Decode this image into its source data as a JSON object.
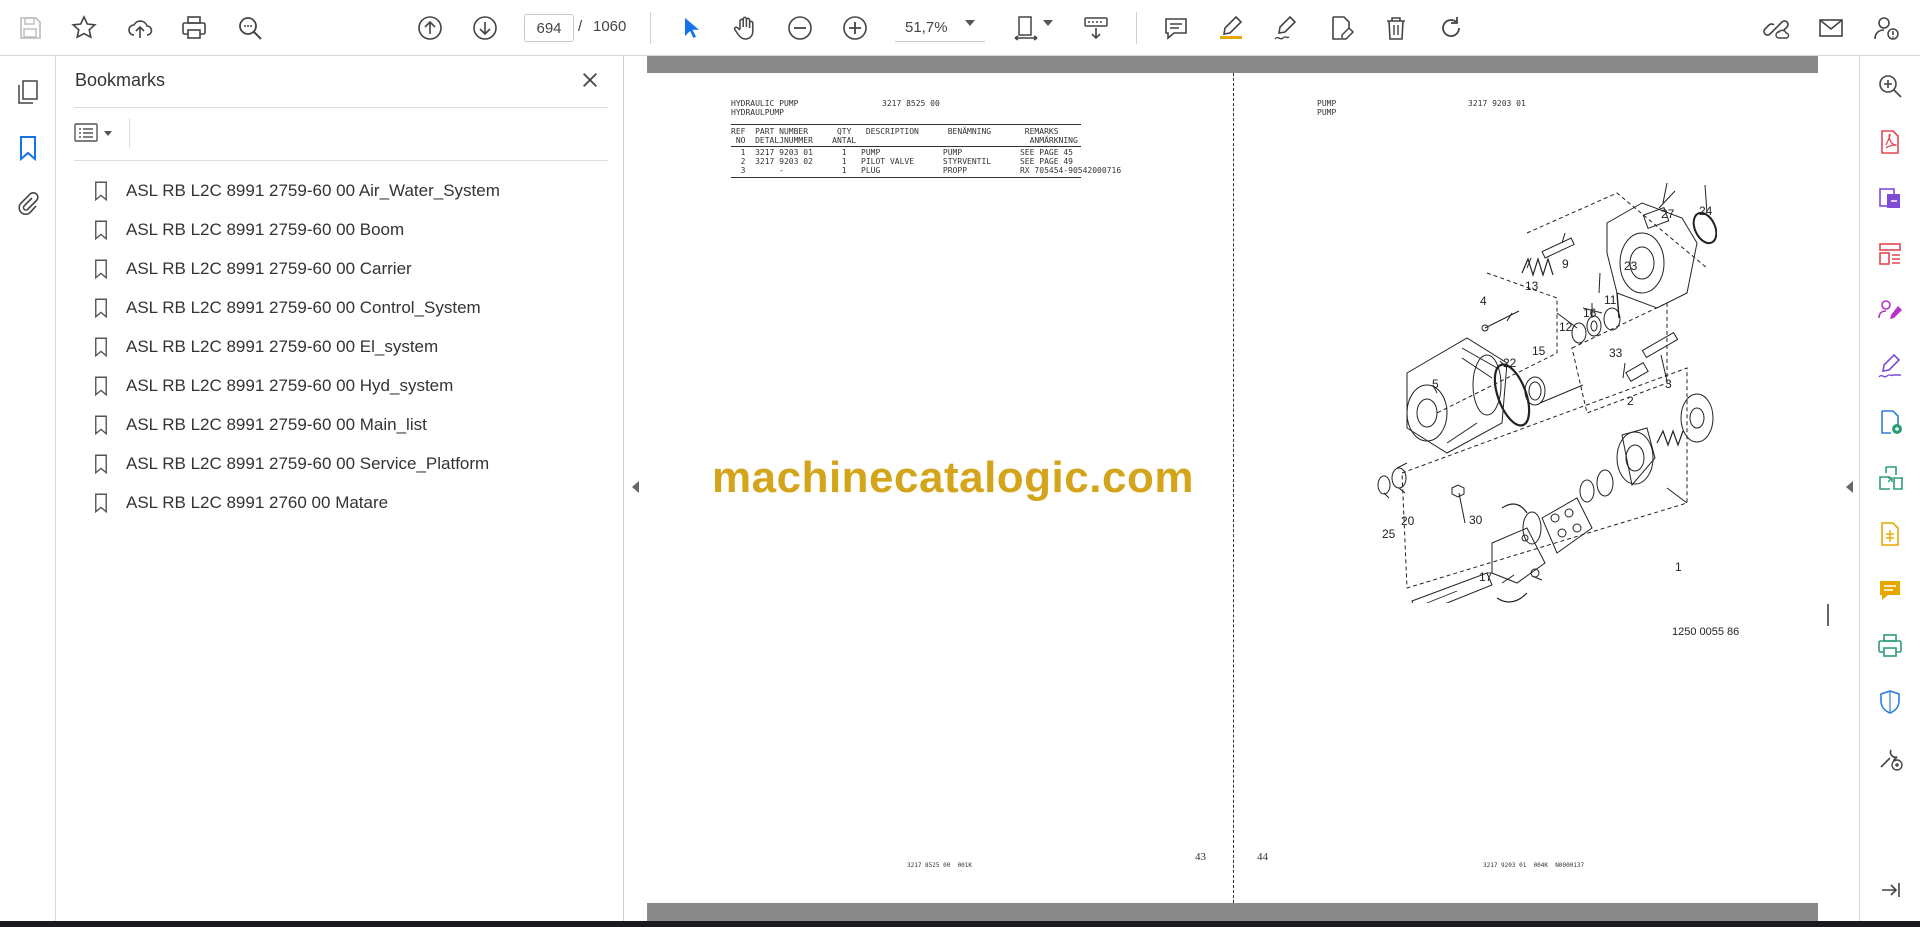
{
  "toolbar": {
    "page_current": "694",
    "page_slash": "/",
    "page_total": "1060",
    "zoom": "51,7%",
    "left_icons": [
      "save-icon",
      "bookmark-star-icon",
      "upload-cloud-icon",
      "print-icon",
      "zoom-search-icon"
    ],
    "nav_icons": [
      "previous-page-icon",
      "next-page-icon"
    ],
    "tool_icons": [
      "select-cursor-icon",
      "hand-pan-icon",
      "zoom-out-icon",
      "zoom-in-icon"
    ],
    "right_icons": [
      "fit-page-icon",
      "scroll-mode-icon",
      "comment-icon",
      "highlight-icon",
      "sign-pen-icon",
      "edit-document-icon",
      "delete-icon",
      "rotate-icon",
      "share-link-icon",
      "email-icon",
      "account-icon"
    ]
  },
  "bookmarks": {
    "title": "Bookmarks",
    "items": [
      "ASL RB L2C 8991 2759-60 00 Air_Water_System",
      "ASL RB L2C 8991 2759-60 00 Boom",
      "ASL RB L2C 8991 2759-60 00 Carrier",
      "ASL RB L2C 8991 2759-60 00 Control_System",
      "ASL RB L2C 8991 2759-60 00 El_system",
      "ASL RB L2C 8991 2759-60 00 Hyd_system",
      "ASL RB L2C 8991 2759-60 00 Main_list",
      "ASL RB L2C 8991 2759-60 00 Service_Platform",
      "ASL RB L2C 8991 2760 00 Matare"
    ]
  },
  "document": {
    "left_page": {
      "title_line1": "HYDRAULIC PUMP",
      "title_line2": "HYDRAULPUMP",
      "part_ref": "3217 8525 00",
      "header_row1": "REF  PART NUMBER      QTY   DESCRIPTION      BENÄMNING       REMARKS",
      "header_row2": " NO  DETALJNUMMER    ANTAL                                    ANMÄRKNING",
      "rows": [
        "  1  3217 9203 01      1   PUMP             PUMP            SEE PAGE 45",
        "  2  3217 9203 02      1   PILOT VALVE      STYRVENTIL      SEE PAGE 49",
        "  3       -            1   PLUG             PROPP           RX 705454-90542000716"
      ],
      "footer": "3217 8525 00  001K",
      "page_number": "43"
    },
    "right_page": {
      "title_line1": "PUMP",
      "title_line2": "PUMP",
      "part_ref": "3217 9203 01",
      "drawing_number": "1250 0055 86",
      "callouts": [
        "27",
        "24",
        "9",
        "23",
        "13",
        "4",
        "16",
        "11",
        "12",
        "15",
        "22",
        "33",
        "3",
        "2",
        "5",
        "25",
        "20",
        "30",
        "1",
        "17",
        "7",
        "17",
        "8"
      ],
      "footer": "3217 9203 01  004K  N0000137",
      "page_number": "44"
    },
    "watermark": "machinecatalogic.com"
  },
  "right_rail": {
    "icons": [
      "zoom-tool-icon",
      "export-pdf-icon",
      "create-pdf-icon",
      "organize-pages-icon",
      "fill-sign-icon",
      "edit-pdf-icon",
      "export-convert-icon",
      "compress-icon",
      "request-signature-icon",
      "comment-tool-icon",
      "print-production-icon",
      "protect-shield-icon",
      "more-tools-icon",
      "collapse-panel-icon"
    ]
  },
  "colors": {
    "accent_blue": "#1473e6",
    "watermark_gold": "#d4a51a",
    "tool_red": "#e34850",
    "tool_purple": "#7e4bd9",
    "tool_yellow": "#e6a700",
    "tool_green": "#2d9d78"
  }
}
